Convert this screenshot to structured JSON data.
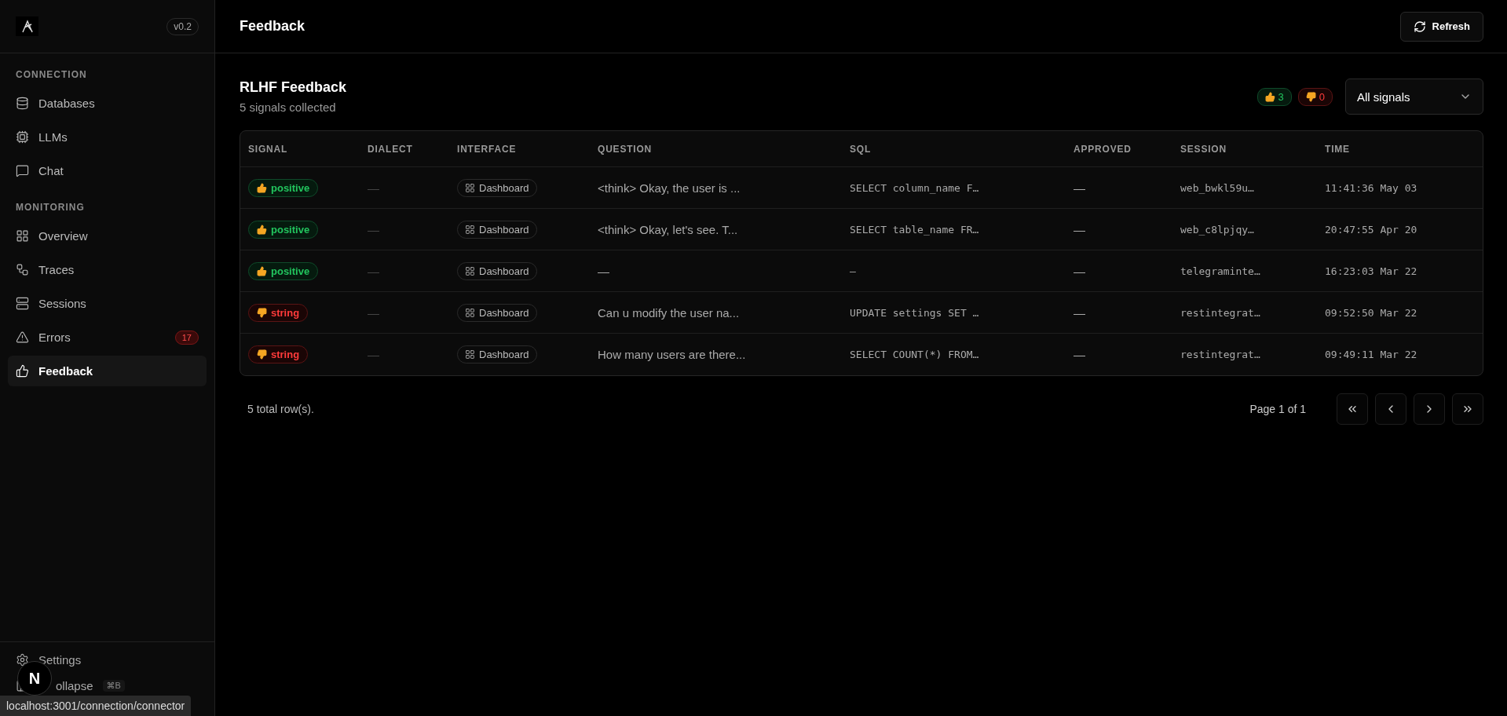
{
  "sidebar": {
    "version": "v0.2",
    "sections": [
      {
        "title": "CONNECTION",
        "items": [
          {
            "label": "Databases",
            "selected": false
          },
          {
            "label": "LLMs",
            "selected": false
          },
          {
            "label": "Chat",
            "selected": false
          }
        ]
      },
      {
        "title": "MONITORING",
        "items": [
          {
            "label": "Overview",
            "selected": false
          },
          {
            "label": "Traces",
            "selected": false
          },
          {
            "label": "Sessions",
            "selected": false
          },
          {
            "label": "Errors",
            "selected": false,
            "badge": "17"
          },
          {
            "label": "Feedback",
            "selected": true
          }
        ]
      }
    ],
    "settings": "Settings",
    "collapse": {
      "label": "ollapse",
      "shortcut": "⌘B"
    }
  },
  "header": {
    "title": "Feedback",
    "refresh": "Refresh"
  },
  "panel": {
    "title": "RLHF Feedback",
    "subtitle": "5 signals collected",
    "positive_count": "3",
    "negative_count": "0",
    "filter": "All signals"
  },
  "table": {
    "columns": [
      "SIGNAL",
      "DIALECT",
      "INTERFACE",
      "QUESTION",
      "SQL",
      "APPROVED",
      "SESSION",
      "TIME"
    ],
    "rows": [
      {
        "signal": {
          "kind": "positive",
          "label": "positive"
        },
        "dialect": "—",
        "interface": "Dashboard",
        "question": "<think> Okay, the user is ...",
        "sql": "SELECT column_name F…",
        "approved": "—",
        "session": "web_bwkl59u…",
        "time": "11:41:36 May 03"
      },
      {
        "signal": {
          "kind": "positive",
          "label": "positive"
        },
        "dialect": "—",
        "interface": "Dashboard",
        "question": "<think> Okay, let's see. T...",
        "sql": "SELECT table_name FR…",
        "approved": "—",
        "session": "web_c8lpjqy…",
        "time": "20:47:55 Apr 20"
      },
      {
        "signal": {
          "kind": "positive",
          "label": "positive"
        },
        "dialect": "—",
        "interface": "Dashboard",
        "question": "—",
        "sql": "–",
        "approved": "—",
        "session": "telegraminte…",
        "time": "16:23:03 Mar 22"
      },
      {
        "signal": {
          "kind": "negative",
          "label": "string"
        },
        "dialect": "—",
        "interface": "Dashboard",
        "question": "Can u modify the user na...",
        "sql": "UPDATE settings SET …",
        "approved": "—",
        "session": "restintegrat…",
        "time": "09:52:50 Mar 22"
      },
      {
        "signal": {
          "kind": "negative",
          "label": "string"
        },
        "dialect": "—",
        "interface": "Dashboard",
        "question": "How many users are there...",
        "sql": "SELECT COUNT(*) FROM…",
        "approved": "—",
        "session": "restintegrat…",
        "time": "09:49:11 Mar 22"
      }
    ]
  },
  "footer": {
    "total": "5 total row(s).",
    "page": "Page 1 of 1",
    "pager": [
      {
        "kind": "first"
      },
      {
        "kind": "prev"
      },
      {
        "kind": "next"
      },
      {
        "kind": "last"
      }
    ]
  },
  "overlay": {
    "next_badge": "N",
    "link_preview": "localhost:3001/connection/connector"
  }
}
